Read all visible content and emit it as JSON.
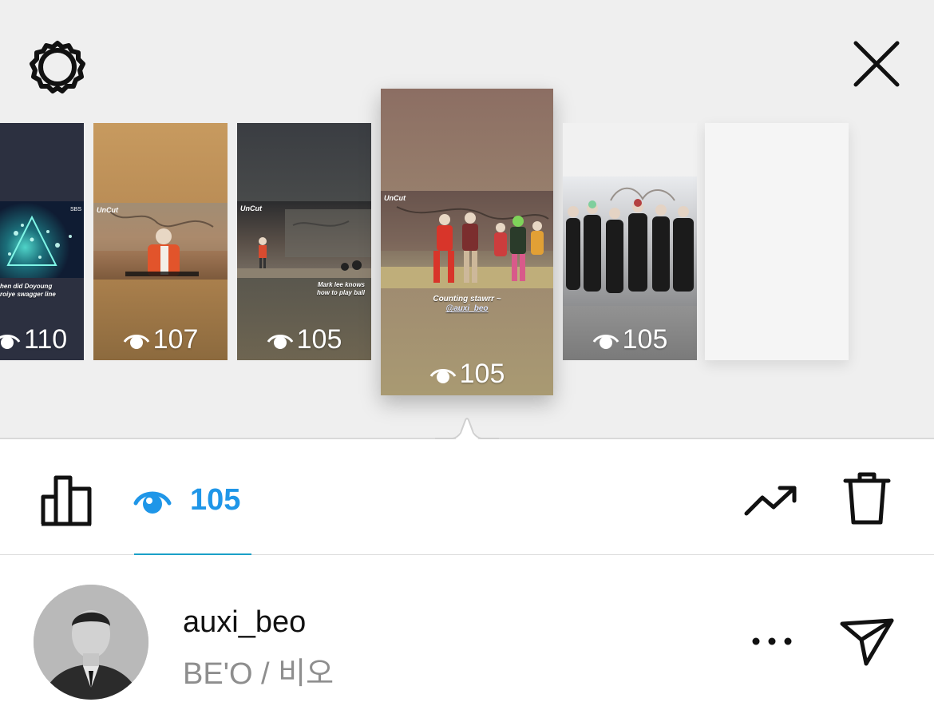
{
  "header": {
    "settings_icon": "gear-icon",
    "close_icon": "close-icon"
  },
  "stories": [
    {
      "views": "110",
      "captions": [
        "hen did Doyoung",
        "roiye swagger line"
      ],
      "badge": "SBS"
    },
    {
      "views": "107",
      "brand": "UnCut"
    },
    {
      "views": "105",
      "brand": "UnCut",
      "captions": [
        "Mark lee knows",
        "how to play ball"
      ]
    },
    {
      "views": "105",
      "brand": "UnCut",
      "captions": [
        "Counting stawrr ~",
        "@auxi_beo"
      ],
      "selected": true
    },
    {
      "views": "105"
    },
    {
      "views": ""
    }
  ],
  "toolbar": {
    "insights_icon": "bar-chart-icon",
    "views_icon": "eye-icon",
    "views_count": "105",
    "promote_icon": "trending-up-icon",
    "delete_icon": "trash-icon"
  },
  "viewer": {
    "username": "auxi_beo",
    "full_name": "BE'O / 비오",
    "more_icon": "more-icon",
    "send_icon": "send-icon"
  },
  "colors": {
    "accent_blue": "#1f96e8",
    "tab_underline": "#1aa0c8",
    "panel_bg": "#efefef"
  }
}
